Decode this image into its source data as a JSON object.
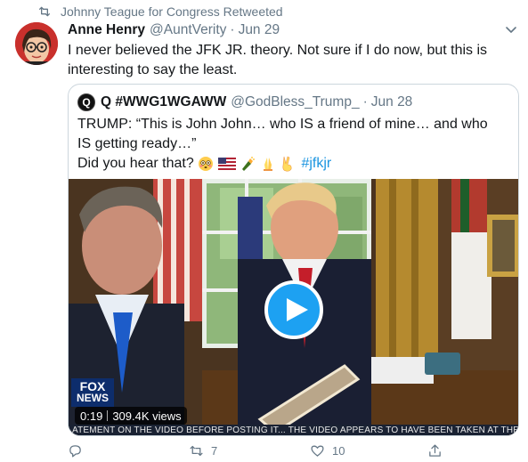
{
  "retweet": {
    "icon": "retweet-icon",
    "text": "Johnny Teague for Congress Retweeted"
  },
  "tweet": {
    "author_name": "Anne Henry",
    "author_handle": "@AuntVerity",
    "separator": "·",
    "date": "Jun 29",
    "text": "I never believed the JFK JR. theory. Not sure if I do now, but this is interesting to say the least."
  },
  "quote": {
    "avatar_letter": "Q",
    "author_name": "Q #WWG1WGAWW",
    "author_handle": "@GodBless_Trump_",
    "separator": "·",
    "date": "Jun 28",
    "line1": "TRUMP: “This is John John… who IS a friend of mine… and who IS getting ready…”",
    "line2_prefix": "Did you hear that?",
    "emojis": [
      "flushed-face",
      "us-flag",
      "champagne",
      "folded-hands",
      "victory-hand"
    ],
    "hashtag": "#jfkjr",
    "video": {
      "time": "0:19",
      "views": "309.4K views",
      "ticker": "ATEMENT ON THE VIDEO BEFORE POSTING IT...   THE VIDEO APPEARS TO HAVE BEEN TAKEN AT THE VILLA",
      "logo_top": "FOX",
      "logo_bottom": "NEWS"
    }
  },
  "actions": {
    "reply_count": "",
    "retweet_count": "7",
    "like_count": "10"
  },
  "colors": {
    "accent": "#1da1f2",
    "muted": "#657786",
    "hashtag": "#1b95e0",
    "border": "#ccd6dd"
  }
}
